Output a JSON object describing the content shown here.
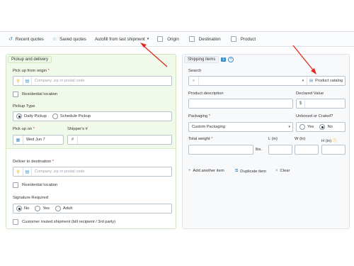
{
  "toolbar": {
    "recent_quotes": "Recent quotes",
    "saved_quotes": "Saved quotes",
    "autofill": "Autofill from last shipment",
    "origin": "Origin",
    "destination": "Destination",
    "product": "Product"
  },
  "pickup": {
    "section_title": "Pickup and delivery",
    "origin_label": "Pick up from origin",
    "origin_placeholder": "Company, zip or postal code",
    "residential_label": "Residential location",
    "pickup_type_label": "Pickup Type",
    "pickup_type_options": [
      "Daily Pickup",
      "Schedule Pickup"
    ],
    "pickup_type_selected": "Daily Pickup",
    "pickup_on_label": "Pick up on",
    "pickup_on_value": "Wed Jun 7",
    "shipper_ref_label": "Shipper's #",
    "shipper_ref_prefix": "#"
  },
  "delivery": {
    "destination_label": "Deliver to destination",
    "destination_placeholder": "Company, zip or postal code",
    "residential_label": "Residential location",
    "signature_label": "Signature Required",
    "signature_options": [
      "No",
      "Yes",
      "Adult"
    ],
    "signature_selected": "No",
    "customer_routed_label": "Customer routed shipment (bill recipient / 3rd party)"
  },
  "shipping_items": {
    "title": "Shipping items",
    "count": "1",
    "search_label": "Search",
    "product_catalog": "Product catalog",
    "description_label": "Product description",
    "declared_value_label": "Declared Value",
    "currency_symbol": "$",
    "packaging_label": "Packaging",
    "packaging_value": "Custom Packaging",
    "uncrated_label": "Unboxed or Crated?",
    "uncrated_options": [
      "Yes",
      "No"
    ],
    "uncrated_selected": "No",
    "total_weight_label": "Total weight",
    "weight_unit": "lbs.",
    "length_label": "L (in)",
    "width_label": "W (in)",
    "height_label": "H (in)",
    "add_item": "Add another item",
    "duplicate_item": "Duplicate item",
    "clear": "Clear"
  },
  "colors": {
    "accent": "#3d8ec9",
    "annotation_arrow": "#e0281e",
    "required": "#d23a3a",
    "green_section": "#f1f9ea"
  }
}
